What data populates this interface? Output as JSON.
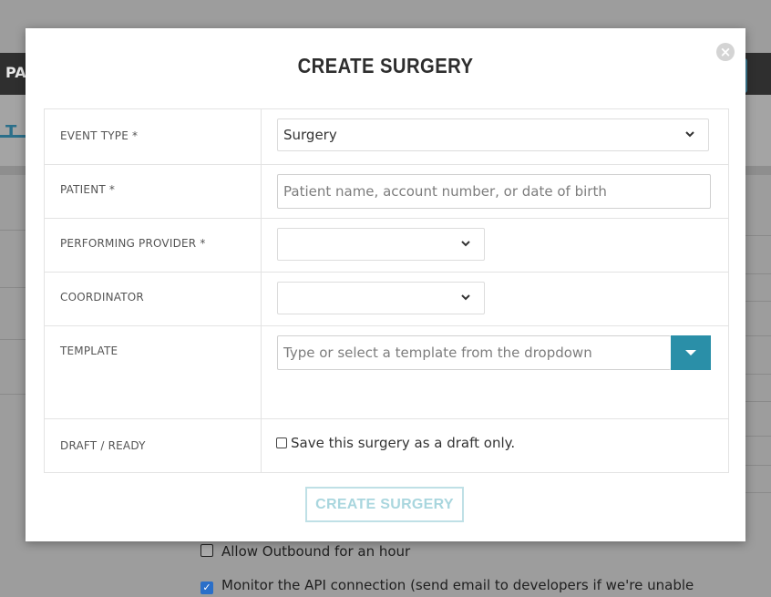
{
  "background": {
    "topbar_label": "PA",
    "tab_label": "T",
    "options": [
      {
        "label": "Allow Outbound for an hour",
        "checked": false
      },
      {
        "label": "Monitor the API connection (send email to developers if we're unable",
        "checked": true
      }
    ]
  },
  "modal": {
    "title": "CREATE SURGERY",
    "close_symbol": "×",
    "fields": {
      "event_type": {
        "label": "EVENT TYPE *",
        "value": "Surgery"
      },
      "patient": {
        "label": "PATIENT *",
        "placeholder": "Patient name, account number, or date of birth"
      },
      "performing_provider": {
        "label": "PERFORMING PROVIDER *",
        "value": ""
      },
      "coordinator": {
        "label": "COORDINATOR",
        "value": ""
      },
      "template": {
        "label": "TEMPLATE",
        "placeholder": "Type or select a template from the dropdown"
      },
      "draft_ready": {
        "label": "DRAFT / READY",
        "checkbox_label": "Save this surgery as a draft only.",
        "checked": false
      }
    },
    "submit_label": "CREATE SURGERY"
  },
  "colors": {
    "accent": "#2a8fa8",
    "submit_disabled_text": "#a9d6de",
    "submit_disabled_border": "#bfe0e6",
    "overlay": "#9d9d9d"
  }
}
